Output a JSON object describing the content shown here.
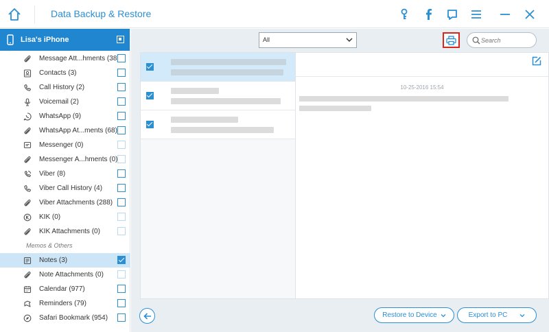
{
  "app": {
    "title": "Data Backup & Restore"
  },
  "device": {
    "name": "Lisa's iPhone"
  },
  "sidebar": {
    "items": [
      {
        "label": "Message Att...hments (38)",
        "icon": "paperclip-icon",
        "checked": false,
        "light": false
      },
      {
        "label": "Contacts (3)",
        "icon": "contact-icon",
        "checked": false,
        "light": false
      },
      {
        "label": "Call History (2)",
        "icon": "phone-icon",
        "checked": false,
        "light": false
      },
      {
        "label": "Voicemail (2)",
        "icon": "microphone-icon",
        "checked": false,
        "light": false
      },
      {
        "label": "WhatsApp (9)",
        "icon": "whatsapp-icon",
        "checked": false,
        "light": false
      },
      {
        "label": "WhatsApp At...ments (68)",
        "icon": "paperclip-icon",
        "checked": false,
        "light": false
      },
      {
        "label": "Messenger (0)",
        "icon": "messenger-icon",
        "checked": false,
        "light": true
      },
      {
        "label": "Messenger A...hments (0)",
        "icon": "paperclip-icon",
        "checked": false,
        "light": true
      },
      {
        "label": "Viber (8)",
        "icon": "viber-icon",
        "checked": false,
        "light": false
      },
      {
        "label": "Viber Call History (4)",
        "icon": "phone-icon",
        "checked": false,
        "light": false
      },
      {
        "label": "Viber Attachments (288)",
        "icon": "paperclip-icon",
        "checked": false,
        "light": false
      },
      {
        "label": "KIK (0)",
        "icon": "kik-icon",
        "checked": false,
        "light": true
      },
      {
        "label": "KIK Attachments (0)",
        "icon": "paperclip-icon",
        "checked": false,
        "light": true
      }
    ],
    "section_label": "Memos & Others",
    "items2": [
      {
        "label": "Notes (3)",
        "icon": "notes-icon",
        "checked": true,
        "light": false,
        "selected": true
      },
      {
        "label": "Note Attachments (0)",
        "icon": "paperclip-icon",
        "checked": false,
        "light": true
      },
      {
        "label": "Calendar (977)",
        "icon": "calendar-icon",
        "checked": false,
        "light": false
      },
      {
        "label": "Reminders (79)",
        "icon": "reminder-icon",
        "checked": false,
        "light": false
      },
      {
        "label": "Safari Bookmark (954)",
        "icon": "compass-icon",
        "checked": false,
        "light": false
      }
    ]
  },
  "toolbar": {
    "filter_value": "All",
    "search_placeholder": "Search"
  },
  "detail": {
    "date": "10-25-2016 15:54"
  },
  "buttons": {
    "restore_label": "Restore to Device",
    "export_label": "Export to PC"
  },
  "colors": {
    "accent": "#2a8fd3",
    "header_blue": "#1f86cf",
    "print_outline": "#d9261c"
  }
}
